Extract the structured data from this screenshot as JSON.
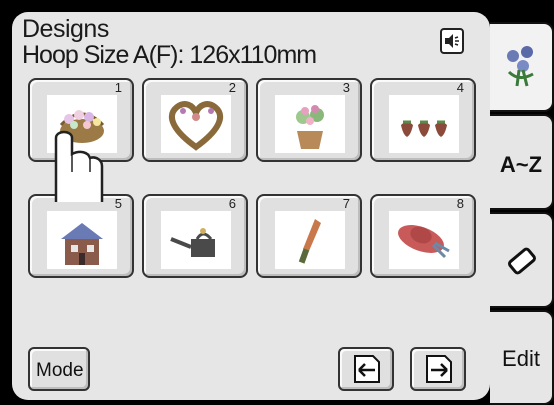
{
  "screen": {
    "title": "Designs",
    "hoop_label": "Hoop Size A(F): 126x110mm"
  },
  "designs": [
    {
      "number": "1",
      "icon": "flower-basket-icon"
    },
    {
      "number": "2",
      "icon": "heart-wreath-icon"
    },
    {
      "number": "3",
      "icon": "flower-pot-icon"
    },
    {
      "number": "4",
      "icon": "strawberries-icon"
    },
    {
      "number": "5",
      "icon": "house-icon"
    },
    {
      "number": "6",
      "icon": "watering-can-icon"
    },
    {
      "number": "7",
      "icon": "trowel-icon"
    },
    {
      "number": "8",
      "icon": "straw-hat-icon"
    }
  ],
  "tabs": {
    "designs_icon": "flowers-tab-icon",
    "az_label": "A~Z",
    "eraser_icon": "eraser-icon",
    "edit_label": "Edit"
  },
  "footer": {
    "mode_label": "Mode",
    "prev_icon": "page-left-icon",
    "next_icon": "page-right-icon"
  },
  "colors": {
    "background": "#000000",
    "panel": "#e6e6e6",
    "button": "#e0e0e0"
  }
}
